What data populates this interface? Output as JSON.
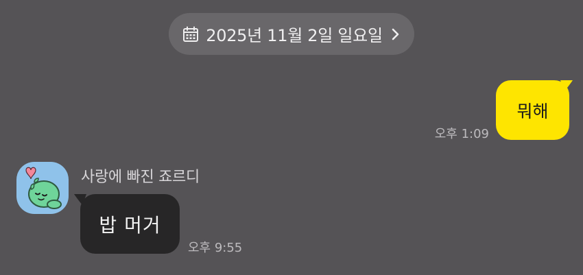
{
  "header": {
    "date_label": "2025년 11월 2일 일요일"
  },
  "messages": [
    {
      "direction": "outgoing",
      "text": "뭐해",
      "time": "오후 1:09"
    },
    {
      "direction": "incoming",
      "sender": "사랑에 빠진 죠르디",
      "text": "밥 머거",
      "time": "오후 9:55"
    }
  ],
  "icons": {
    "date": "calendar-icon",
    "nav": "chevron-right-icon"
  },
  "colors": {
    "background": "#555356",
    "date_pill": "#69676a",
    "outgoing_bubble": "#fee500",
    "incoming_bubble": "#272627",
    "avatar_bg": "#8fc2ea"
  }
}
